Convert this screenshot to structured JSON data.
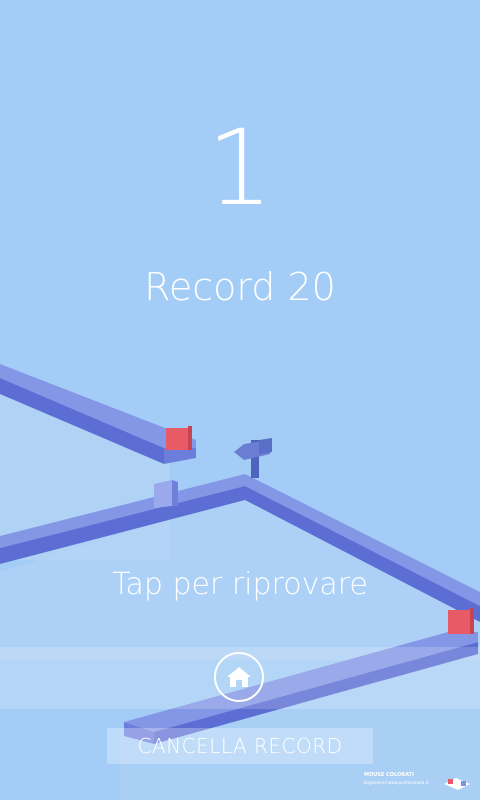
{
  "game": {
    "score": "1",
    "record_text": "Record 20",
    "retry_text": "Tap per riprovare",
    "reset_label": "CANCELLA RECORD",
    "home_icon": "home-icon",
    "brand_title": "MOUSE COLORATI",
    "brand_sub": "Engineered www.puntoinmeta.it"
  },
  "colors": {
    "background": "#a3cdf6",
    "path_top": "#7e92e4",
    "path_side": "#5d6ed4",
    "flag_red": "#e85a66",
    "sign_post": "#5d73c7",
    "text": "#ffffff"
  }
}
